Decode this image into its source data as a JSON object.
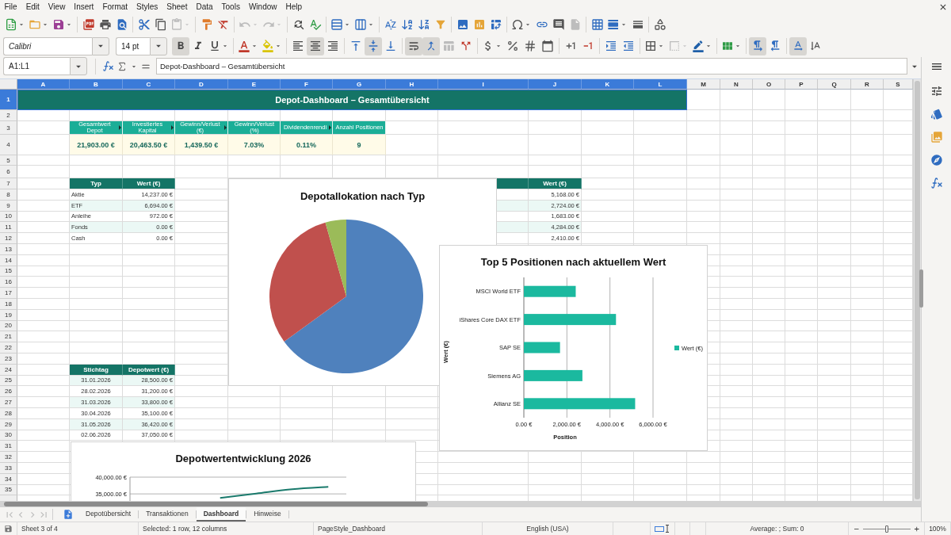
{
  "menu_bar": {
    "items": [
      "File",
      "Edit",
      "View",
      "Insert",
      "Format",
      "Styles",
      "Sheet",
      "Data",
      "Tools",
      "Window",
      "Help"
    ]
  },
  "standard_toolbar": {
    "paste": {
      "disabled": true
    },
    "undo": {
      "disabled": true
    },
    "redo": {
      "disabled": true
    },
    "header_footer": {
      "disabled": true
    }
  },
  "formatting_toolbar": {
    "font_name": "Calibri",
    "font_size": "14 pt",
    "bold": {
      "active": true
    },
    "italic": {
      "active": false
    },
    "underline": {
      "active": false
    },
    "align_left": {
      "active": false
    },
    "align_center": {
      "active": true
    },
    "align_right": {
      "active": false
    },
    "align_top": {
      "active": false
    },
    "align_middle": {
      "active": true
    },
    "align_bottom": {
      "active": false
    },
    "wrap_text": {
      "active": true
    },
    "merge_and_center": {
      "active": true
    },
    "merge_cells": {
      "disabled": true
    },
    "border_style": {
      "disabled": true
    },
    "left_to_right": {
      "active": true
    },
    "right_to_left": {
      "active": false
    },
    "horizontal_text": {
      "active": true
    },
    "vertical_text": {
      "active": false
    }
  },
  "formula_bar": {
    "name_box": "A1:L1",
    "content": "Depot-Dashboard – Gesamtübersicht"
  },
  "sheet": {
    "columns": [
      {
        "label": "A",
        "selected": true
      },
      {
        "label": "B",
        "selected": true
      },
      {
        "label": "C",
        "selected": true
      },
      {
        "label": "D",
        "selected": true
      },
      {
        "label": "E",
        "selected": true
      },
      {
        "label": "F",
        "selected": true
      },
      {
        "label": "G",
        "selected": true
      },
      {
        "label": "H",
        "selected": true
      },
      {
        "label": "I",
        "selected": true
      },
      {
        "label": "J",
        "selected": true
      },
      {
        "label": "K",
        "selected": true
      },
      {
        "label": "L",
        "selected": true
      },
      {
        "label": "M",
        "selected": false
      },
      {
        "label": "N",
        "selected": false
      },
      {
        "label": "O",
        "selected": false
      },
      {
        "label": "P",
        "selected": false
      },
      {
        "label": "Q",
        "selected": false
      },
      {
        "label": "R",
        "selected": false
      },
      {
        "label": "S",
        "selected": false
      }
    ],
    "rows": [
      {
        "label": "1",
        "selected": true
      },
      {
        "label": "2",
        "selected": false
      },
      {
        "label": "3",
        "selected": false
      },
      {
        "label": "4",
        "selected": false
      },
      {
        "label": "5",
        "selected": false
      },
      {
        "label": "6",
        "selected": false
      },
      {
        "label": "7",
        "selected": false
      },
      {
        "label": "8",
        "selected": false
      },
      {
        "label": "9",
        "selected": false
      },
      {
        "label": "10",
        "selected": false
      },
      {
        "label": "11",
        "selected": false
      },
      {
        "label": "12",
        "selected": false
      },
      {
        "label": "13",
        "selected": false
      },
      {
        "label": "14",
        "selected": false
      },
      {
        "label": "15",
        "selected": false
      },
      {
        "label": "16",
        "selected": false
      },
      {
        "label": "17",
        "selected": false
      },
      {
        "label": "18",
        "selected": false
      },
      {
        "label": "19",
        "selected": false
      },
      {
        "label": "20",
        "selected": false
      },
      {
        "label": "21",
        "selected": false
      },
      {
        "label": "22",
        "selected": false
      },
      {
        "label": "23",
        "selected": false
      },
      {
        "label": "24",
        "selected": false
      },
      {
        "label": "25",
        "selected": false
      },
      {
        "label": "26",
        "selected": false
      },
      {
        "label": "27",
        "selected": false
      },
      {
        "label": "28",
        "selected": false
      },
      {
        "label": "29",
        "selected": false
      },
      {
        "label": "30",
        "selected": false
      },
      {
        "label": "31",
        "selected": false
      },
      {
        "label": "32",
        "selected": false
      },
      {
        "label": "33",
        "selected": false
      },
      {
        "label": "34",
        "selected": false
      },
      {
        "label": "35",
        "selected": false
      }
    ],
    "title": "Depot-Dashboard – Gesamtübersicht",
    "kpis": [
      {
        "label": "Gesamtwert Depot",
        "value": "21,903.00 €",
        "overflow": true
      },
      {
        "label": "Investiertes Kapital",
        "value": "20,463.50 €",
        "overflow": true
      },
      {
        "label": "Gewinn/Verlust (€)",
        "value": "1,439.50 €",
        "overflow": true
      },
      {
        "label": "Gewinn/Verlust (%)",
        "value": "7.03%",
        "overflow": false
      },
      {
        "label": "Dividendenrendi",
        "value": "0.11%",
        "overflow": true
      },
      {
        "label": "Anzahl Positionen",
        "value": "9",
        "overflow": false
      }
    ],
    "allocation_table": {
      "columns": [
        "Typ",
        "Wert (€)"
      ],
      "rows": [
        [
          "Aktie",
          "14,237.00 €"
        ],
        [
          "ETF",
          "6,694.00 €"
        ],
        [
          "Anleihe",
          "972.00 €"
        ],
        [
          "Fonds",
          "0.00 €"
        ],
        [
          "Cash",
          "0.00 €"
        ]
      ]
    },
    "positions_table": {
      "columns": [
        "Wert (€)"
      ],
      "rows": [
        [
          "5,168.00 €"
        ],
        [
          "2,724.00 €"
        ],
        [
          "1,683.00 €"
        ],
        [
          "4,284.00 €"
        ],
        [
          "2,410.00 €"
        ]
      ]
    },
    "history_table": {
      "columns": [
        "Stichtag",
        "Depotwert (€)"
      ],
      "rows": [
        [
          "31.01.2026",
          "28,500.00 €"
        ],
        [
          "28.02.2026",
          "31,200.00 €"
        ],
        [
          "31.03.2026",
          "33,800.00 €"
        ],
        [
          "30.04.2026",
          "35,100.00 €"
        ],
        [
          "31.05.2026",
          "36,420.00 €"
        ],
        [
          "02.06.2026",
          "37,050.00 €"
        ]
      ]
    },
    "charts": [
      {
        "chart_data": {
          "type": "pie",
          "title": "Depotallokation nach Typ",
          "values": [
            65,
            30.6,
            4.4
          ]
        }
      },
      {
        "chart_data": {
          "type": "bar",
          "orientation": "horizontal",
          "title": "Top 5 Positionen nach aktuellem Wert",
          "xlabel": "Position",
          "ylabel": "Wert (€)",
          "categories": [
            "MSCI World ETF",
            "iShares Core DAX ETF",
            "SAP SE",
            "Siemens AG",
            "Allianz SE"
          ],
          "series": [
            {
              "name": "Wert (€)",
              "color": "#1bb99f",
              "values": [
                2410,
                4280,
                1680,
                2720,
                5170
              ]
            }
          ],
          "xlim": [
            0,
            6000
          ],
          "xticks": [
            {
              "value": 0,
              "label": "0.00 €"
            },
            {
              "value": 2000,
              "label": "2,000.00 €"
            },
            {
              "value": 4000,
              "label": "4,000.00 €"
            },
            {
              "value": 6000,
              "label": "6,000.00 €"
            }
          ]
        }
      },
      {
        "chart_data": {
          "type": "line",
          "title": "Depotwertentwicklung 2026",
          "series": [
            {
              "color": "#1a7a6c",
              "values": [
                null,
                null,
                33800,
                35100,
                36400,
                37100
              ]
            }
          ],
          "ylim": [
            32900,
            40000
          ],
          "yticks": [
            {
              "value": 35000,
              "label": "35,000.00 €"
            },
            {
              "value": 40000,
              "label": "40,000.00 €"
            }
          ]
        }
      }
    ]
  },
  "sheet_tabs": {
    "navigation": {
      "disabled": true
    },
    "tabs": [
      {
        "label": "Depotübersicht",
        "selected": false
      },
      {
        "label": "Transaktionen",
        "selected": false
      },
      {
        "label": "Dashboard",
        "selected": true
      },
      {
        "label": "Hinweise",
        "selected": false
      }
    ]
  },
  "status_bar": {
    "sheet": "Sheet 3 of 4",
    "selection": "Selected: 1 row, 12 columns",
    "page_style": "PageStyle_Dashboard",
    "language": "English (USA)",
    "summary": "Average: ; Sum: 0",
    "zoom_slider": {
      "level": 0.5
    },
    "zoom": "100%"
  }
}
